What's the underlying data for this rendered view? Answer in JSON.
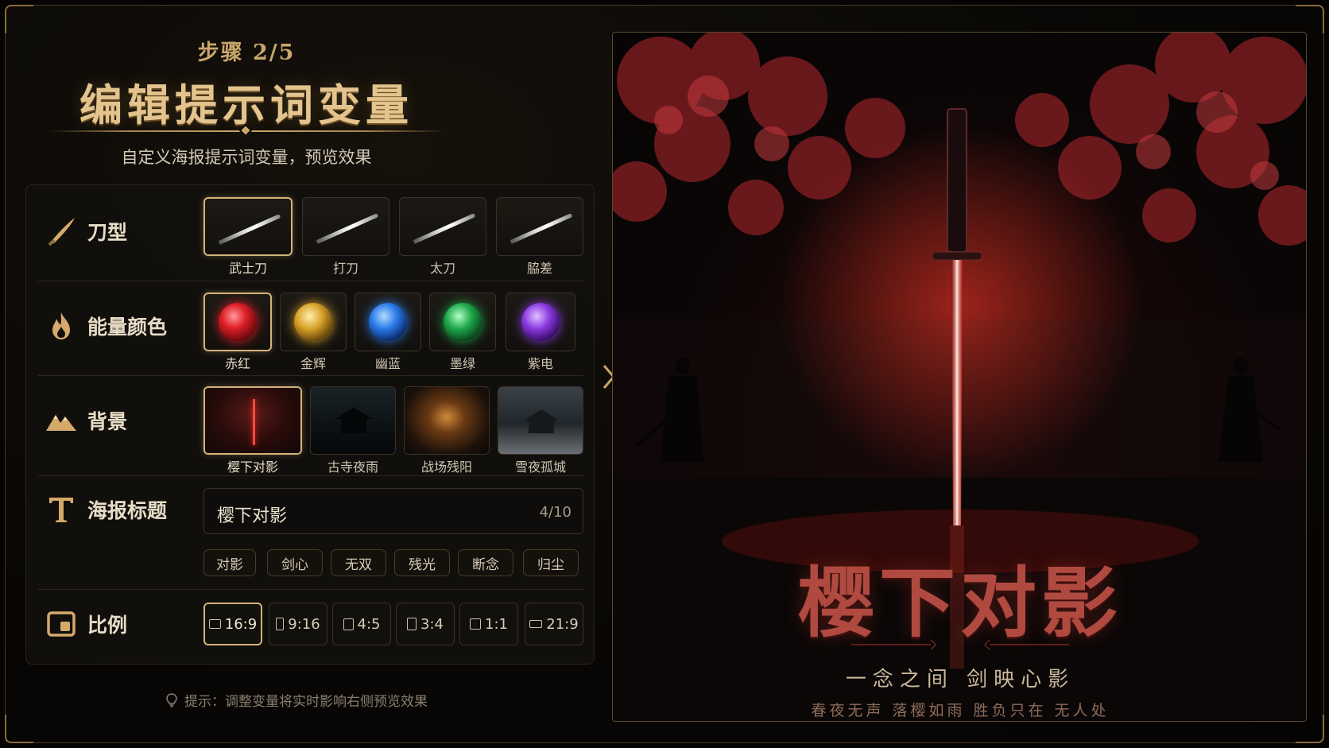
{
  "header": {
    "step": "步骤 2/5",
    "title": "编辑提示词变量",
    "subtitle": "自定义海报提示词变量，预览效果"
  },
  "sections": {
    "blade": {
      "label": "刀型",
      "options": [
        "武士刀",
        "打刀",
        "太刀",
        "脇差"
      ],
      "selected": "武士刀"
    },
    "energy": {
      "label": "能量颜色",
      "options": [
        {
          "name": "赤红",
          "color": "#e0202a"
        },
        {
          "name": "金辉",
          "color": "#d9a22a"
        },
        {
          "name": "幽蓝",
          "color": "#2a7ae8"
        },
        {
          "name": "墨绿",
          "color": "#1fa84a"
        },
        {
          "name": "紫电",
          "color": "#8a3ae0"
        }
      ],
      "selected": "赤红"
    },
    "background": {
      "label": "背景",
      "options": [
        "樱下对影",
        "古寺夜雨",
        "战场残阳",
        "雪夜孤城"
      ],
      "selected": "樱下对影"
    },
    "poster_title": {
      "label": "海报标题",
      "value": "樱下对影",
      "counter": "4/10",
      "suggestions": [
        "对影",
        "剑心",
        "无双",
        "残光",
        "断念",
        "归尘"
      ]
    },
    "ratio": {
      "label": "比例",
      "options": [
        "16:9",
        "9:16",
        "4:5",
        "3:4",
        "1:1",
        "21:9"
      ],
      "selected": "16:9"
    }
  },
  "hint": "提示：调整变量将实时影响右侧预览效果",
  "poster": {
    "title": "樱下对影",
    "tagline": "一念之间  剑映心影",
    "sub": "春夜无声  落樱如雨  胜负只在  无人处"
  },
  "colors": {
    "accent_gold": "#d4b27a",
    "energy_red": "#e0202a"
  }
}
